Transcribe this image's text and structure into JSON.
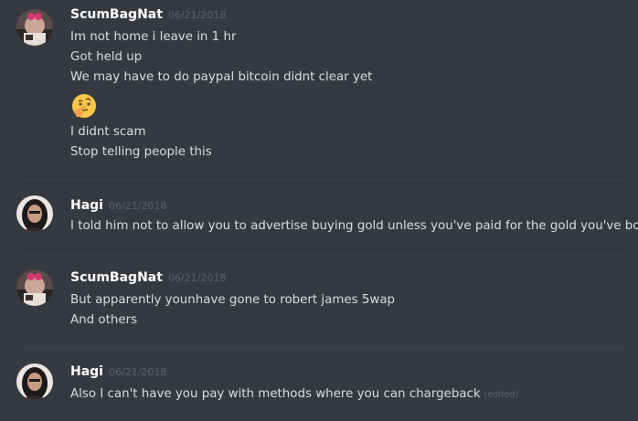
{
  "messages": [
    {
      "username": "ScumBagNat",
      "timestamp": "06/21/2018",
      "avatar": "scumbagnat-avatar",
      "lines": [
        "Im not home i leave in 1 hr",
        "Got held up",
        "We may have to do paypal bitcoin didnt clear yet",
        "I didnt scam",
        "Stop telling people this"
      ],
      "emoji": "thinking-face-emoji"
    },
    {
      "username": "Hagi",
      "timestamp": "06/21/2018",
      "avatar": "hagi-avatar",
      "lines": [
        "I told him not to allow you to advertise buying gold unless you've paid for the gold you've bought"
      ]
    },
    {
      "username": "ScumBagNat",
      "timestamp": "06/21/2018",
      "avatar": "scumbagnat-avatar",
      "lines": [
        "But apparently younhave gone to robert james 5wap",
        "And others"
      ]
    },
    {
      "username": "Hagi",
      "timestamp": "06/21/2018",
      "avatar": "hagi-avatar",
      "lines": [
        "Also I can't have you pay with methods where you can chargeback"
      ],
      "edited_label": "(edited)"
    }
  ],
  "colors": {
    "background": "#36393f",
    "username": "#ffffff",
    "message_text": "#dcddde",
    "timestamp": "#5d6067",
    "divider": "#3f4248"
  }
}
